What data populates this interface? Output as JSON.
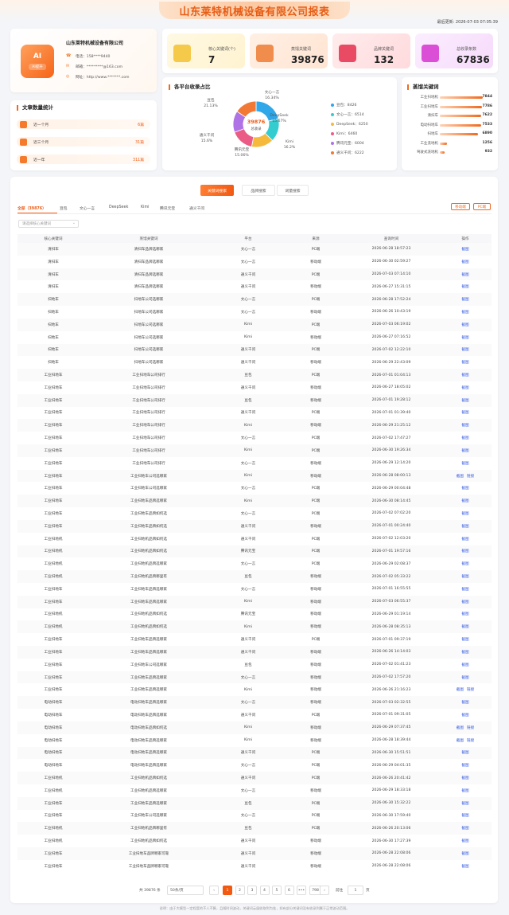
{
  "page": {
    "title": "山东莱特机械设备有限公司报表",
    "update_time": "最后更新: 2026-07-03 07:05:39"
  },
  "company": {
    "name": "山东莱特机械设备有限公司",
    "logo_text": "AI",
    "logo_tag": "AI提升",
    "phone": "电话：158****9440",
    "email": "邮箱：*********@163.com",
    "website": "网址：http://www.*******.com"
  },
  "stats": [
    {
      "label": "核心关键词(个)",
      "value": "7",
      "icon": "stack-icon"
    },
    {
      "label": "蒸馏关键词",
      "value": "39876",
      "icon": "stack-icon"
    },
    {
      "label": "品牌关键词",
      "value": "132",
      "icon": "stack-icon"
    },
    {
      "label": "总收录条数",
      "value": "67836",
      "icon": "stack-icon"
    }
  ],
  "articles": {
    "title": "文章数量统计",
    "items": [
      {
        "label": "近一个月",
        "count": "6篇"
      },
      {
        "label": "近三个月",
        "count": "31篇"
      },
      {
        "label": "近一年",
        "count": "311篇"
      }
    ]
  },
  "pie": {
    "title": "各平台收录占比",
    "center_value": "39876",
    "center_label": "总收录",
    "slices": [
      {
        "label": "豆包",
        "pct": "21.13%",
        "value": 8426,
        "color": "#2fa7e8"
      },
      {
        "label": "文心一言",
        "pct": "16.34%",
        "value": 6514,
        "color": "#33cdd0"
      },
      {
        "label": "DeepSeek",
        "pct": "15.67%",
        "value": 6250,
        "color": "#f5b93c"
      },
      {
        "label": "Kimi",
        "pct": "16.2%",
        "value": 6460,
        "color": "#ea5c85"
      },
      {
        "label": "腾讯元宝",
        "pct": "15.06%",
        "value": 6004,
        "color": "#b073e6"
      },
      {
        "label": "通义千问",
        "pct": "15.6%",
        "value": 6222,
        "color": "#f27935"
      }
    ],
    "legend": [
      "豆包：8426",
      "文心一言：6514",
      "DeepSeek：6250",
      "Kimi：6460",
      "腾讯元宝：6004",
      "通义千问：6222"
    ]
  },
  "keywords": {
    "title": "蒸馏关键词",
    "items": [
      {
        "name": "工业扫地机",
        "value": "7844",
        "ratio": 1.0
      },
      {
        "name": "工业扫地车",
        "value": "7786",
        "ratio": 0.99
      },
      {
        "name": "清扫车",
        "value": "7622",
        "ratio": 0.97
      },
      {
        "name": "电动扫地车",
        "value": "7533",
        "ratio": 0.96
      },
      {
        "name": "扫地车",
        "value": "6890",
        "ratio": 0.88
      },
      {
        "name": "工业洗地机",
        "value": "1256",
        "ratio": 0.16
      },
      {
        "name": "驾驶式洗地机",
        "value": "932",
        "ratio": 0.12
      }
    ]
  },
  "main_tabs": [
    "关键词搜索",
    "品牌搜索",
    "词量搜索"
  ],
  "platform_tabs": [
    "全部（39876）",
    "豆包",
    "文心一言",
    "DeepSeek",
    "Kimi",
    "腾讯元宝",
    "通义千问"
  ],
  "device_buttons": [
    "移动端",
    "PC端"
  ],
  "filter_placeholder": "请选择核心关键词",
  "table": {
    "headers": [
      "核心关键词",
      "蒸馏关键词",
      "平台",
      "来源",
      "查询时间",
      "操作"
    ],
    "rows": [
      [
        "清扫车",
        "清扫车品牌选哪家",
        "文心一言",
        "PC端",
        "2026-06-28 18:57:23",
        "截图",
        ""
      ],
      [
        "清扫车",
        "清扫车品牌选哪家",
        "文心一言",
        "移动端",
        "2026-06-30 02:59:27",
        "截图",
        ""
      ],
      [
        "清扫车",
        "清扫车品牌选哪家",
        "通义千问",
        "PC端",
        "2026-07-03 07:14:10",
        "截图",
        ""
      ],
      [
        "清扫车",
        "清扫车品牌选哪家",
        "通义千问",
        "移动端",
        "2026-06-27 15:31:15",
        "截图",
        ""
      ],
      [
        "扫地车",
        "扫地车公司选哪家",
        "文心一言",
        "PC端",
        "2026-06-28 17:52:24",
        "截图",
        ""
      ],
      [
        "扫地车",
        "扫地车公司选哪家",
        "文心一言",
        "移动端",
        "2026-06-26 10:43:19",
        "截图",
        ""
      ],
      [
        "扫地车",
        "扫地车公司选哪家",
        "Kimi",
        "PC端",
        "2026-07-03 06:19:02",
        "截图",
        ""
      ],
      [
        "扫地车",
        "扫地车公司选哪家",
        "Kimi",
        "移动端",
        "2026-06-27 07:16:52",
        "截图",
        ""
      ],
      [
        "扫地车",
        "扫地车公司选哪家",
        "通义千问",
        "PC端",
        "2026-07-02 12:22:10",
        "截图",
        ""
      ],
      [
        "扫地车",
        "扫地车公司选哪家",
        "通义千问",
        "移动端",
        "2026-06-29 22:43:09",
        "截图",
        ""
      ],
      [
        "工业扫地车",
        "工业扫地车公司排行",
        "豆包",
        "PC端",
        "2026-07-01 01:04:13",
        "截图",
        ""
      ],
      [
        "工业扫地车",
        "工业扫地车公司排行",
        "通义千问",
        "移动端",
        "2026-06-27 18:05:02",
        "截图",
        ""
      ],
      [
        "工业扫地车",
        "工业扫地车公司排行",
        "豆包",
        "移动端",
        "2026-07-01 19:28:12",
        "截图",
        ""
      ],
      [
        "工业扫地车",
        "工业扫地车公司排行",
        "通义千问",
        "PC端",
        "2026-07-01 01:39:40",
        "截图",
        ""
      ],
      [
        "工业扫地车",
        "工业扫地车公司排行",
        "Kimi",
        "移动端",
        "2026-06-29 21:25:12",
        "截图",
        ""
      ],
      [
        "工业扫地车",
        "工业扫地车公司排行",
        "文心一言",
        "PC端",
        "2026-07-02 17:47:27",
        "截图",
        ""
      ],
      [
        "工业扫地车",
        "工业扫地车公司排行",
        "Kimi",
        "PC端",
        "2026-06-30 19:26:34",
        "截图",
        ""
      ],
      [
        "工业扫地车",
        "工业扫地车公司排行",
        "文心一言",
        "移动端",
        "2026-06-29 12:14:20",
        "截图",
        ""
      ],
      [
        "工业扫地车",
        "工业扫地车公司选哪家",
        "Kimi",
        "移动端",
        "2026-06-28 08:00:13",
        "截图",
        "链接"
      ],
      [
        "工业扫地车",
        "工业扫地车公司选哪家",
        "文心一言",
        "PC端",
        "2026-06-29 00:04:48",
        "截图",
        ""
      ],
      [
        "工业扫地车",
        "工业扫地车品牌选哪家",
        "Kimi",
        "PC端",
        "2026-06-30 08:14:45",
        "截图",
        ""
      ],
      [
        "工业扫地车",
        "工业扫地车品牌如何选",
        "文心一言",
        "PC端",
        "2026-07-02 07:02:20",
        "截图",
        ""
      ],
      [
        "工业扫地车",
        "工业扫地车品牌如何选",
        "通义千问",
        "移动端",
        "2026-07-01 00:24:40",
        "截图",
        ""
      ],
      [
        "工业扫地机",
        "工业扫地机品牌如何选",
        "通义千问",
        "PC端",
        "2026-07-02 12:03:20",
        "截图",
        ""
      ],
      [
        "工业扫地机",
        "工业扫地机品牌如何选",
        "腾讯元宝",
        "PC端",
        "2026-07-01 19:57:16",
        "截图",
        ""
      ],
      [
        "工业扫地机",
        "工业扫地机品牌选哪家",
        "文心一言",
        "PC端",
        "2026-06-29 02:08:37",
        "截图",
        ""
      ],
      [
        "工业扫地机",
        "工业扫地机品牌哪里有",
        "豆包",
        "移动端",
        "2026-07-02 05:33:22",
        "截图",
        ""
      ],
      [
        "工业扫地车",
        "工业扫地车品牌选哪家",
        "文心一言",
        "移动端",
        "2026-07-01 16:55:55",
        "截图",
        ""
      ],
      [
        "工业扫地车",
        "工业扫地车品牌选哪家",
        "Kimi",
        "移动端",
        "2026-07-03 06:55:37",
        "截图",
        ""
      ],
      [
        "工业扫地机",
        "工业扫地机品牌如何选",
        "腾讯元宝",
        "移动端",
        "2026-06-29 01:19:14",
        "截图",
        ""
      ],
      [
        "工业扫地机",
        "工业扫地机品牌如何选",
        "Kimi",
        "移动端",
        "2026-06-28 08:35:13",
        "截图",
        ""
      ],
      [
        "工业扫地车",
        "工业扫地车品牌选哪家",
        "通义千问",
        "PC端",
        "2026-07-01 09:37:19",
        "截图",
        ""
      ],
      [
        "工业扫地车",
        "工业扫地车品牌选哪家",
        "通义千问",
        "移动端",
        "2026-06-26 14:14:03",
        "截图",
        ""
      ],
      [
        "工业扫地车",
        "工业扫地车公司选哪家",
        "豆包",
        "移动端",
        "2026-07-02 01:41:23",
        "截图",
        ""
      ],
      [
        "工业扫地车",
        "工业扫地车品牌选哪家",
        "文心一言",
        "移动端",
        "2026-07-02 17:57:20",
        "截图",
        ""
      ],
      [
        "工业扫地车",
        "工业扫地车品牌选哪家",
        "Kimi",
        "移动端",
        "2026-06-26 21:16:23",
        "截图",
        "链接"
      ],
      [
        "电动扫地车",
        "电动扫地车品牌选哪家",
        "文心一言",
        "移动端",
        "2026-07-03 02:32:55",
        "截图",
        ""
      ],
      [
        "电动扫地车",
        "电动扫地车品牌选哪家",
        "通义千问",
        "PC端",
        "2026-07-01 09:31:05",
        "截图",
        ""
      ],
      [
        "电动扫地车",
        "电动扫地车品牌如何选",
        "Kimi",
        "移动端",
        "2026-06-29 07:37:45",
        "截图",
        "链接"
      ],
      [
        "电动扫地车",
        "电动扫地车品牌选哪家",
        "Kimi",
        "移动端",
        "2026-06-28 18:39:44",
        "截图",
        "链接"
      ],
      [
        "电动扫地车",
        "电动扫地车品牌选哪家",
        "通义千问",
        "PC端",
        "2026-06-30 15:51:51",
        "截图",
        ""
      ],
      [
        "电动扫地车",
        "电动扫地车品牌选哪家",
        "文心一言",
        "PC端",
        "2026-06-29 04:01:35",
        "截图",
        ""
      ],
      [
        "工业扫地机",
        "工业扫地机品牌如何选",
        "通义千问",
        "PC端",
        "2026-06-26 20:41:42",
        "截图",
        ""
      ],
      [
        "工业扫地机",
        "工业扫地机品牌选哪家",
        "文心一言",
        "移动端",
        "2026-06-29 18:33:18",
        "截图",
        ""
      ],
      [
        "工业扫地车",
        "工业扫地车品牌选哪家",
        "豆包",
        "PC端",
        "2026-06-30 15:32:22",
        "截图",
        ""
      ],
      [
        "工业扫地车",
        "工业扫地车公司选哪家",
        "文心一言",
        "PC端",
        "2026-06-30 17:59:40",
        "截图",
        ""
      ],
      [
        "工业扫地机",
        "工业扫地机品牌哪里有",
        "豆包",
        "PC端",
        "2026-06-26 20:13:06",
        "截图",
        ""
      ],
      [
        "工业扫地机",
        "工业扫地机品牌如何选",
        "通义千问",
        "移动端",
        "2026-06-30 17:27:39",
        "截图",
        ""
      ],
      [
        "工业扫地车",
        "工业扫地车品牌哪家可靠",
        "通义千问",
        "移动端",
        "2026-06-28 22:08:06",
        "截图",
        ""
      ],
      [
        "工业扫地车",
        "工业扫地车品牌哪家可靠",
        "通义千问",
        "移动端",
        "2026-06-28 22:08:06",
        "截图",
        ""
      ]
    ]
  },
  "pagination": {
    "total": "共 39876 条",
    "page_size": "50条/页",
    "prev": "‹",
    "next": "›",
    "pages": [
      "1",
      "2",
      "3",
      "4",
      "5",
      "6",
      "•••",
      "798"
    ],
    "goto_label": "前往",
    "goto_value": "1",
    "goto_unit": "页"
  },
  "footer": "说明：由于大模型一定程度的不人不算，且随时间波动，关键词云展收取到为准，如有部分关键词没有收录到属于正常波动范围。"
}
